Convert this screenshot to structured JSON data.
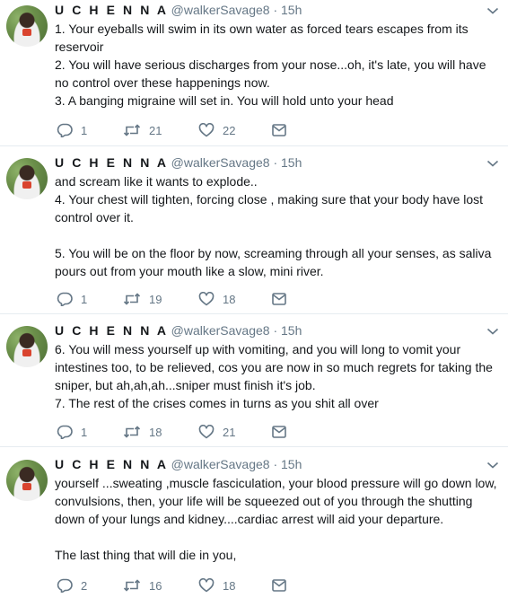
{
  "tweets": [
    {
      "name": "U C H E N N A",
      "handle": "@walkerSavage8",
      "dot": "·",
      "time": "15h",
      "lines": [
        "1. Your eyeballs will swim in its own water as forced tears escapes from its reservoir",
        "2. You will have serious discharges from your nose...oh, it's late, you will have no control over these happenings now.",
        "3. A banging migraine will set in. You will hold unto your head"
      ],
      "replies": "1",
      "retweets": "21",
      "likes": "22"
    },
    {
      "name": "U C H E N N A",
      "handle": "@walkerSavage8",
      "dot": "·",
      "time": "15h",
      "lines": [
        "and scream like it wants to explode..",
        "4. Your chest will tighten, forcing close , making sure that your body have lost control over it.",
        "",
        "5. You will be on the floor by now, screaming through all your senses, as saliva pours out from your mouth like a slow, mini river."
      ],
      "replies": "1",
      "retweets": "19",
      "likes": "18"
    },
    {
      "name": "U C H E N N A",
      "handle": "@walkerSavage8",
      "dot": "·",
      "time": "15h",
      "lines": [
        "6. You will mess yourself up with vomiting, and you will long to vomit your intestines too, to be relieved, cos you are now in so much regrets for taking the sniper, but ah,ah,ah...sniper must finish it's job.",
        "7. The rest of the crises comes in turns as you shit all over"
      ],
      "replies": "1",
      "retweets": "18",
      "likes": "21"
    },
    {
      "name": "U C H E N N A",
      "handle": "@walkerSavage8",
      "dot": "·",
      "time": "15h",
      "lines": [
        "yourself ...sweating ,muscle fasciculation, your blood pressure will go down low, convulsions, then, your life will be squeezed out of you through the shutting down of your lungs and kidney....cardiac arrest will aid your departure.",
        "",
        "The last thing that will die in you,"
      ],
      "replies": "2",
      "retweets": "16",
      "likes": "18"
    }
  ],
  "icons": {
    "reply": "reply-icon",
    "retweet": "retweet-icon",
    "like": "heart-icon",
    "dm": "envelope-icon",
    "caret": "chevron-down-icon"
  },
  "colors": {
    "text": "#14171a",
    "muted": "#657786",
    "divider": "#e6ecf0"
  }
}
